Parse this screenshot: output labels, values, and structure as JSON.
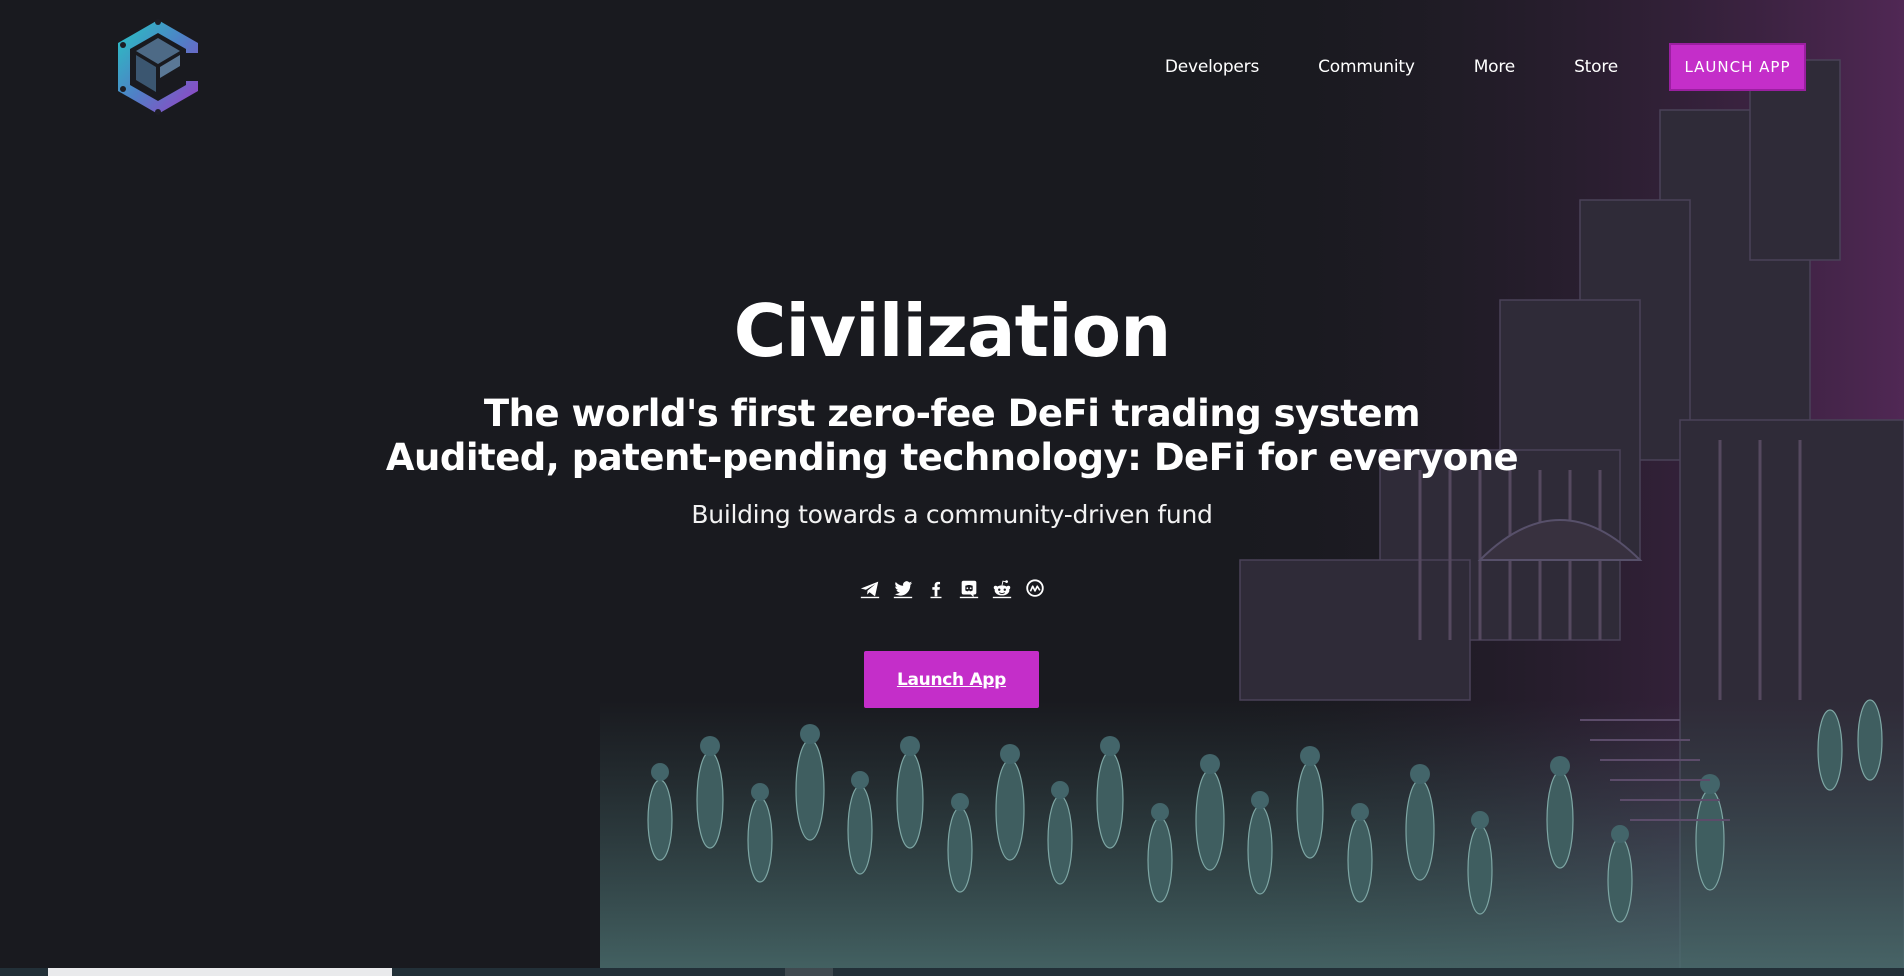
{
  "header": {
    "logo_icon": "civilization-logo-icon",
    "nav": [
      {
        "label": "Developers"
      },
      {
        "label": "Community"
      },
      {
        "label": "More"
      },
      {
        "label": "Store"
      }
    ],
    "launch_label": "LAUNCH APP"
  },
  "hero": {
    "title": "Civilization",
    "subtitle_line1": "The world's first zero-fee DeFi trading system",
    "subtitle_line2": "Audited, patent-pending technology: DeFi for everyone",
    "tagline": "Building towards a community-driven fund",
    "socials": [
      {
        "icon": "telegram-icon"
      },
      {
        "icon": "twitter-icon"
      },
      {
        "icon": "facebook-icon"
      },
      {
        "icon": "discord-icon"
      },
      {
        "icon": "reddit-icon"
      },
      {
        "icon": "coinmarketcap-icon"
      }
    ],
    "cta_label": "Launch App"
  },
  "colors": {
    "background": "#191a1f",
    "accent": "#c42ec9",
    "logo_teal": "#25c7c3",
    "logo_purple": "#9a3ec4",
    "art_teal": "#5f8a8a",
    "art_purple": "#6b2f6e"
  }
}
